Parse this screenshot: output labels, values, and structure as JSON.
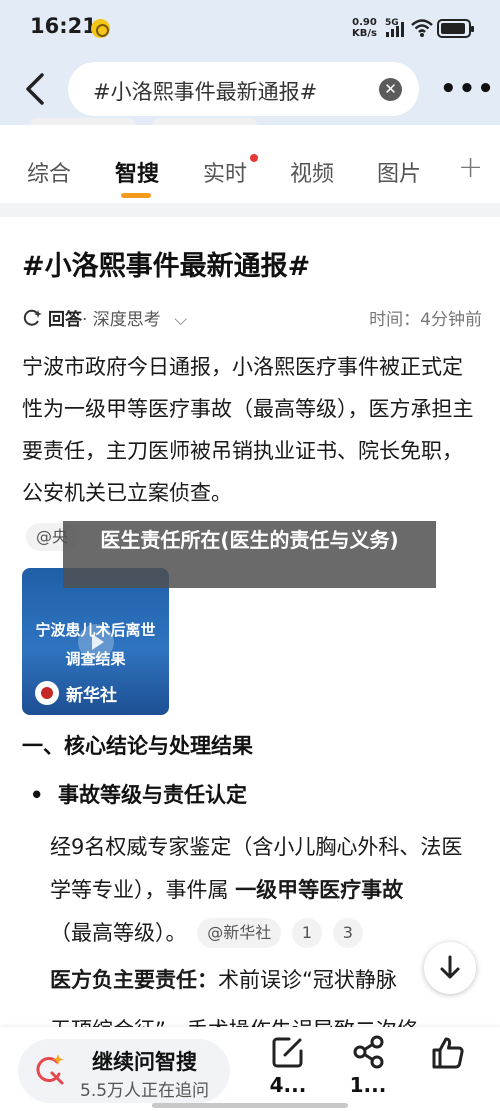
{
  "status_bar": {
    "time": "16:21",
    "net_speed": "0.90",
    "net_unit": "KB/s",
    "network": "5G",
    "icons": [
      "notification-icon",
      "signal-icon",
      "wifi-icon",
      "battery-icon"
    ]
  },
  "header": {
    "search_query": "#小洛熙事件最新通报#",
    "icons": [
      "back-icon",
      "clear-icon",
      "more-icon"
    ]
  },
  "tabs": [
    {
      "label": "综合",
      "active": false
    },
    {
      "label": "智搜",
      "active": true
    },
    {
      "label": "实时",
      "active": false,
      "badge": "red-dot"
    },
    {
      "label": "视频",
      "active": false
    },
    {
      "label": "图片",
      "active": false
    }
  ],
  "main": {
    "title": "#小洛熙事件最新通报#",
    "answer_label": "回答",
    "answer_mode": "· 深度思考",
    "elapsed": "时间：4分钟前",
    "paragraph": "宁波市政府今日通报，小洛熙医疗事件被正式定性为一级甲等医疗事故（最高等级），医方承担主要责任，主刀医师被吊销执业证书、院长免职，公安机关已立案侦查。",
    "source_tag": "@央",
    "overlay_text": "医生责任所在(医生的责任与义务)",
    "video": {
      "title_line1": "宁波患儿术后离世",
      "title_line2": "调查结果",
      "publisher": "新华社"
    },
    "section_heading": "一、核心结论与处理结果",
    "bullet_heading": "事故等级与责任认定",
    "bullet_text_pre": "经9名权威专家鉴定（含小儿胸心外科、法医学等专业），事件属 ",
    "bullet_text_bold": "一级甲等医疗事故",
    "bullet_text_post": "（最高等级）。",
    "cite_source": "@新华社",
    "cite_1": "1",
    "cite_3": "3",
    "para3_label": "医方负主要责任：",
    "para3_line1": "术前误诊“冠状静脉",
    "para3_line2": "无顶综合征”、手术操作失误导致二次修"
  },
  "bottom_bar": {
    "ask_title": "继续问智搜",
    "ask_subtitle": "5.5万人正在追问",
    "comment_count": "4...",
    "share_count": "1...",
    "icons": [
      "ask-ai-icon",
      "comment-icon",
      "share-icon",
      "like-icon"
    ]
  }
}
